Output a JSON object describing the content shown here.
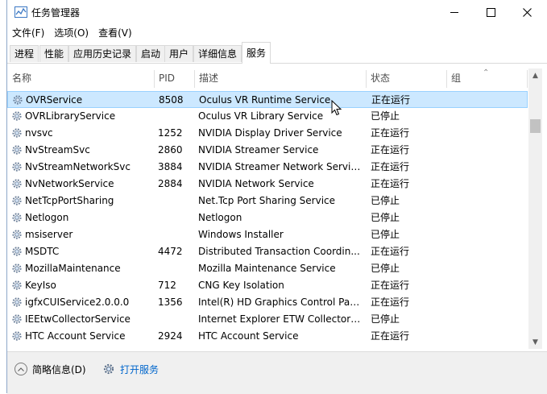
{
  "window": {
    "title": "任务管理器"
  },
  "menu": [
    "文件(F)",
    "选项(O)",
    "查看(V)"
  ],
  "tabs": [
    {
      "label": "进程",
      "active": false
    },
    {
      "label": "性能",
      "active": false
    },
    {
      "label": "应用历史记录",
      "active": false
    },
    {
      "label": "启动",
      "active": false
    },
    {
      "label": "用户",
      "active": false
    },
    {
      "label": "详细信息",
      "active": false
    },
    {
      "label": "服务",
      "active": true
    }
  ],
  "columns": {
    "name": "名称",
    "pid": "PID",
    "desc": "描述",
    "status": "状态",
    "group": "组"
  },
  "rows": [
    {
      "name": "OVRService",
      "pid": "8508",
      "desc": "Oculus VR Runtime Service",
      "status": "正在运行",
      "selected": true
    },
    {
      "name": "OVRLibraryService",
      "pid": "",
      "desc": "Oculus VR Library Service",
      "status": "已停止"
    },
    {
      "name": "nvsvc",
      "pid": "1252",
      "desc": "NVIDIA Display Driver Service",
      "status": "正在运行"
    },
    {
      "name": "NvStreamSvc",
      "pid": "2860",
      "desc": "NVIDIA Streamer Service",
      "status": "正在运行"
    },
    {
      "name": "NvStreamNetworkSvc",
      "pid": "3884",
      "desc": "NVIDIA Streamer Network Service",
      "status": "正在运行"
    },
    {
      "name": "NvNetworkService",
      "pid": "2884",
      "desc": "NVIDIA Network Service",
      "status": "正在运行"
    },
    {
      "name": "NetTcpPortSharing",
      "pid": "",
      "desc": "Net.Tcp Port Sharing Service",
      "status": "已停止"
    },
    {
      "name": "Netlogon",
      "pid": "",
      "desc": "Netlogon",
      "status": "已停止"
    },
    {
      "name": "msiserver",
      "pid": "",
      "desc": "Windows Installer",
      "status": "已停止"
    },
    {
      "name": "MSDTC",
      "pid": "4472",
      "desc": "Distributed Transaction Coordin...",
      "status": "正在运行"
    },
    {
      "name": "MozillaMaintenance",
      "pid": "",
      "desc": "Mozilla Maintenance Service",
      "status": "已停止"
    },
    {
      "name": "KeyIso",
      "pid": "712",
      "desc": "CNG Key Isolation",
      "status": "正在运行"
    },
    {
      "name": "igfxCUIService2.0.0.0",
      "pid": "1356",
      "desc": "Intel(R) HD Graphics Control Pan...",
      "status": "正在运行"
    },
    {
      "name": "IEEtwCollectorService",
      "pid": "",
      "desc": "Internet Explorer ETW Collector ...",
      "status": "已停止"
    },
    {
      "name": "HTC Account Service",
      "pid": "2924",
      "desc": "HTC Account Service",
      "status": "正在运行"
    }
  ],
  "footer": {
    "collapse_label": "简略信息(D)",
    "open_services_label": "打开服务"
  },
  "colors": {
    "selection": "#cce8ff",
    "highlight_box": "#e0484d",
    "link": "#0066cc"
  }
}
